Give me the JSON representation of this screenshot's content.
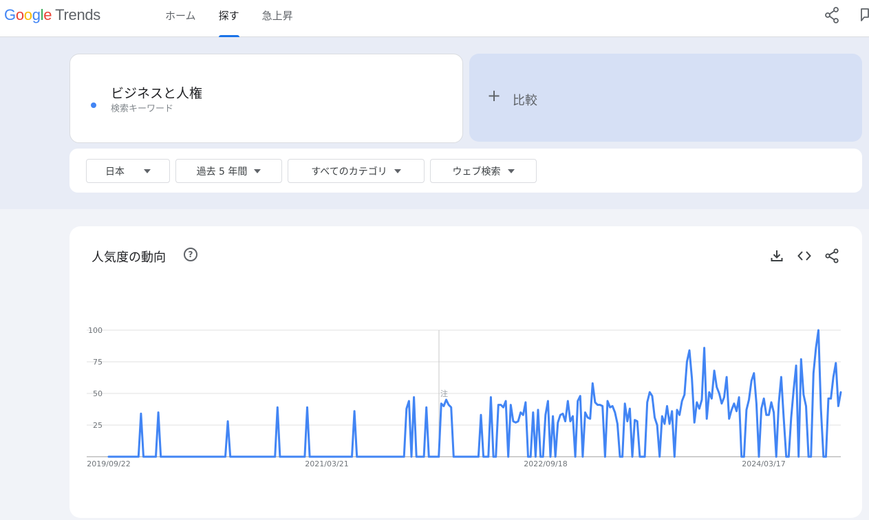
{
  "brand": {
    "google": "Google",
    "product": "Trends"
  },
  "nav": [
    {
      "label": "ホーム",
      "active": false
    },
    {
      "label": "探す",
      "active": true
    },
    {
      "label": "急上昇",
      "active": false
    }
  ],
  "search_term": {
    "term": "ビジネスと人権",
    "type": "検索キーワード",
    "color": "#4285f4"
  },
  "compare": {
    "plus": "+",
    "label": "比較"
  },
  "filters": [
    {
      "label": "日本"
    },
    {
      "label": "過去 5 年間"
    },
    {
      "label": "すべてのカテゴリ"
    },
    {
      "label": "ウェブ検索"
    }
  ],
  "interest_card": {
    "title": "人気度の動向",
    "help": "?",
    "note_marker": "注"
  },
  "icons": [
    "share-icon",
    "flag-icon",
    "help-icon",
    "download-icon",
    "embed-icon"
  ],
  "chart_data": {
    "type": "line",
    "title": "人気度の動向",
    "series": [
      {
        "name": "ビジネスと人権",
        "color": "#4285f4"
      }
    ],
    "y_ticks": [
      25,
      50,
      75,
      100
    ],
    "ylim": [
      0,
      100
    ],
    "x_tick_labels": [
      "2019/09/22",
      "2021/03/21",
      "2022/09/18",
      "2024/03/17"
    ],
    "x_range": [
      "2019/09/22",
      "2024/09/08"
    ],
    "grid": true,
    "values": [
      0,
      0,
      0,
      0,
      0,
      0,
      0,
      0,
      0,
      0,
      0,
      0,
      0,
      34,
      0,
      0,
      0,
      0,
      0,
      0,
      35,
      0,
      0,
      0,
      0,
      0,
      0,
      0,
      0,
      0,
      0,
      0,
      0,
      0,
      0,
      0,
      0,
      0,
      0,
      0,
      0,
      0,
      0,
      0,
      0,
      0,
      0,
      0,
      28,
      0,
      0,
      0,
      0,
      0,
      0,
      0,
      0,
      0,
      0,
      0,
      0,
      0,
      0,
      0,
      0,
      0,
      0,
      0,
      39,
      0,
      0,
      0,
      0,
      0,
      0,
      0,
      0,
      0,
      0,
      0,
      39,
      0,
      0,
      0,
      0,
      0,
      0,
      0,
      0,
      0,
      0,
      0,
      0,
      0,
      0,
      0,
      0,
      0,
      0,
      36,
      0,
      0,
      0,
      0,
      0,
      0,
      0,
      0,
      0,
      0,
      0,
      0,
      0,
      0,
      0,
      0,
      0,
      0,
      0,
      0,
      38,
      44,
      0,
      47,
      0,
      0,
      0,
      0,
      39,
      0,
      0,
      0,
      0,
      0,
      42,
      40,
      45,
      41,
      39,
      0,
      0,
      0,
      0,
      0,
      0,
      0,
      0,
      0,
      0,
      0,
      33,
      0,
      0,
      0,
      47,
      0,
      0,
      41,
      41,
      39,
      44,
      0,
      41,
      28,
      27,
      28,
      35,
      33,
      43,
      0,
      0,
      35,
      0,
      37,
      0,
      0,
      33,
      44,
      0,
      32,
      0,
      27,
      33,
      34,
      28,
      44,
      28,
      32,
      0,
      44,
      48,
      0,
      35,
      31,
      30,
      58,
      43,
      41,
      41,
      40,
      0,
      44,
      39,
      40,
      35,
      26,
      0,
      0,
      42,
      28,
      38,
      0,
      29,
      28,
      0,
      0,
      0,
      43,
      51,
      48,
      31,
      25,
      0,
      32,
      26,
      40,
      26,
      36,
      0,
      37,
      33,
      44,
      49,
      75,
      84,
      62,
      27,
      43,
      38,
      45,
      86,
      30,
      51,
      46,
      68,
      55,
      50,
      42,
      47,
      63,
      30,
      37,
      42,
      36,
      47,
      0,
      0,
      37,
      45,
      60,
      66,
      42,
      0,
      38,
      46,
      33,
      33,
      43,
      35,
      0,
      42,
      63,
      31,
      0,
      0,
      31,
      53,
      72,
      0,
      77,
      49,
      40,
      0,
      0,
      66,
      86,
      100,
      38,
      0,
      0,
      46,
      46,
      63,
      74,
      40,
      51
    ]
  }
}
